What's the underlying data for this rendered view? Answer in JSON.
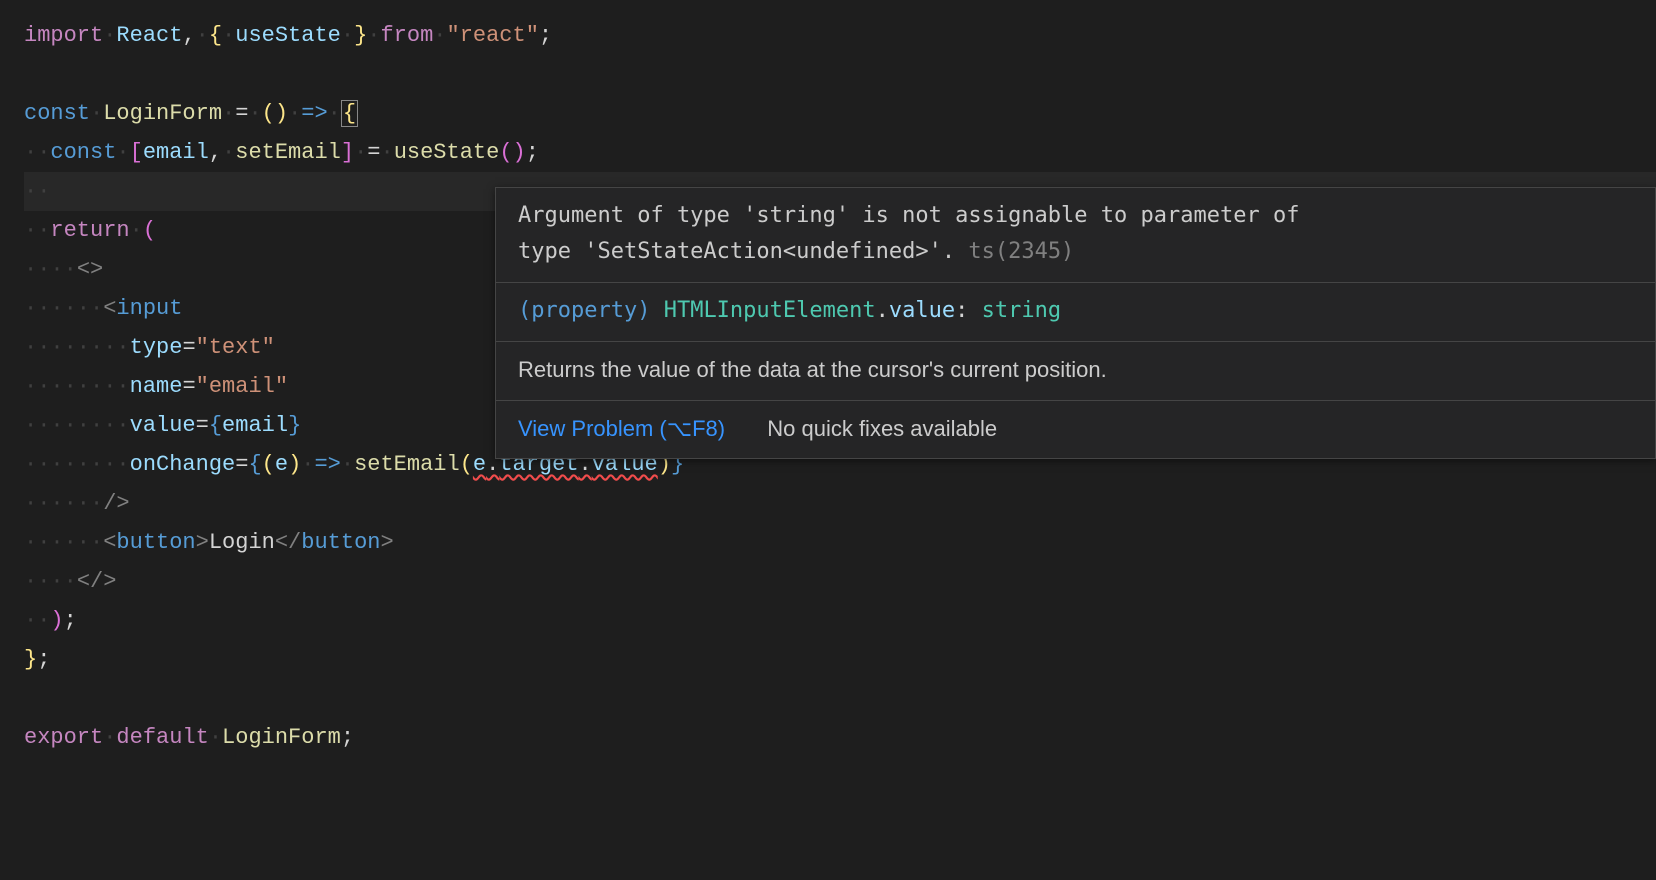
{
  "code": {
    "l1": {
      "import": "import",
      "react": "React",
      "useState": "useState",
      "from": "from",
      "mod": "\"react\""
    },
    "l3": {
      "const": "const",
      "name": "LoginForm",
      "arrow": "=>"
    },
    "l4": {
      "const": "const",
      "email": "email",
      "setEmail": "setEmail",
      "useState": "useState"
    },
    "l6": {
      "return": "return"
    },
    "l8": {
      "tag": "input"
    },
    "l9": {
      "attr": "type",
      "val": "\"text\""
    },
    "l10": {
      "attr": "name",
      "val": "\"email\""
    },
    "l11": {
      "attr": "value",
      "expr": "email"
    },
    "l12": {
      "attr": "onChange",
      "param": "e",
      "fn": "setEmail",
      "a": "e",
      "b": "target",
      "c": "value"
    },
    "l14": {
      "tag": "button",
      "text": "Login"
    },
    "l19": {
      "export": "export",
      "default": "default",
      "name": "LoginForm"
    }
  },
  "hover": {
    "error_a": "Argument of type 'string' is not assignable to parameter of",
    "error_b": "type 'SetStateAction<undefined>'.",
    "tscode": "ts(2345)",
    "sig_prop": "(property)",
    "sig_type1": "HTMLInputElement",
    "sig_member": "value",
    "sig_rettype": "string",
    "doc": "Returns the value of the data at the cursor's current position.",
    "view_problem": "View Problem (⌥F8)",
    "no_quick_fix": "No quick fixes available"
  }
}
